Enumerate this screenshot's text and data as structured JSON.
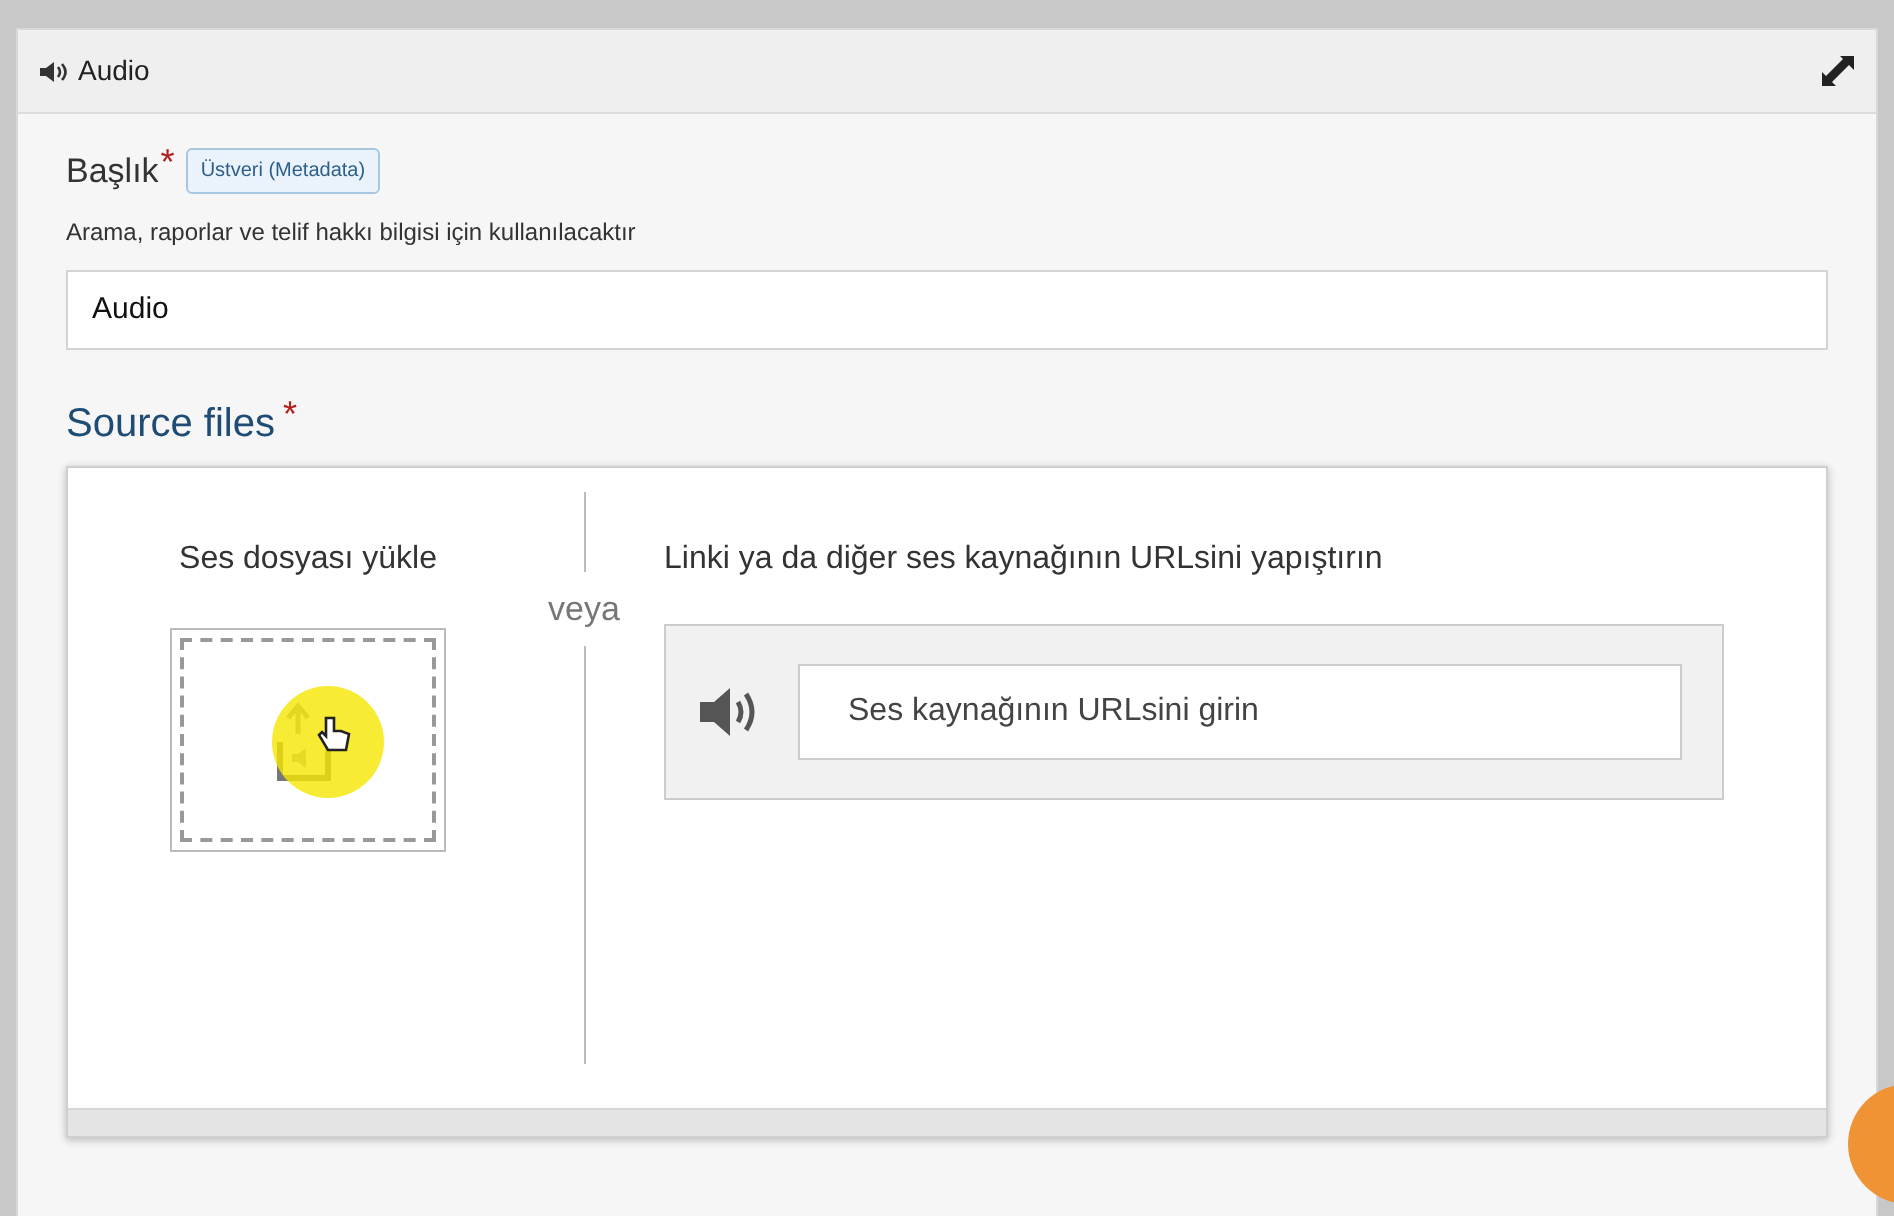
{
  "header": {
    "title": "Audio"
  },
  "title_field": {
    "label": "Başlık",
    "required_mark": "*",
    "tag": "Üstveri (Metadata)",
    "hint": "Arama, raporlar ve telif hakkı bilgisi için kullanılacaktır",
    "value": "Audio"
  },
  "source_files": {
    "label": "Source files",
    "required_mark": "*",
    "upload_label": "Ses dosyası yükle",
    "separator": "veya",
    "url_label": "Linki ya da diğer ses kaynağının URLsini yapıştırın",
    "url_placeholder": "Ses kaynağının URLsini girin"
  }
}
